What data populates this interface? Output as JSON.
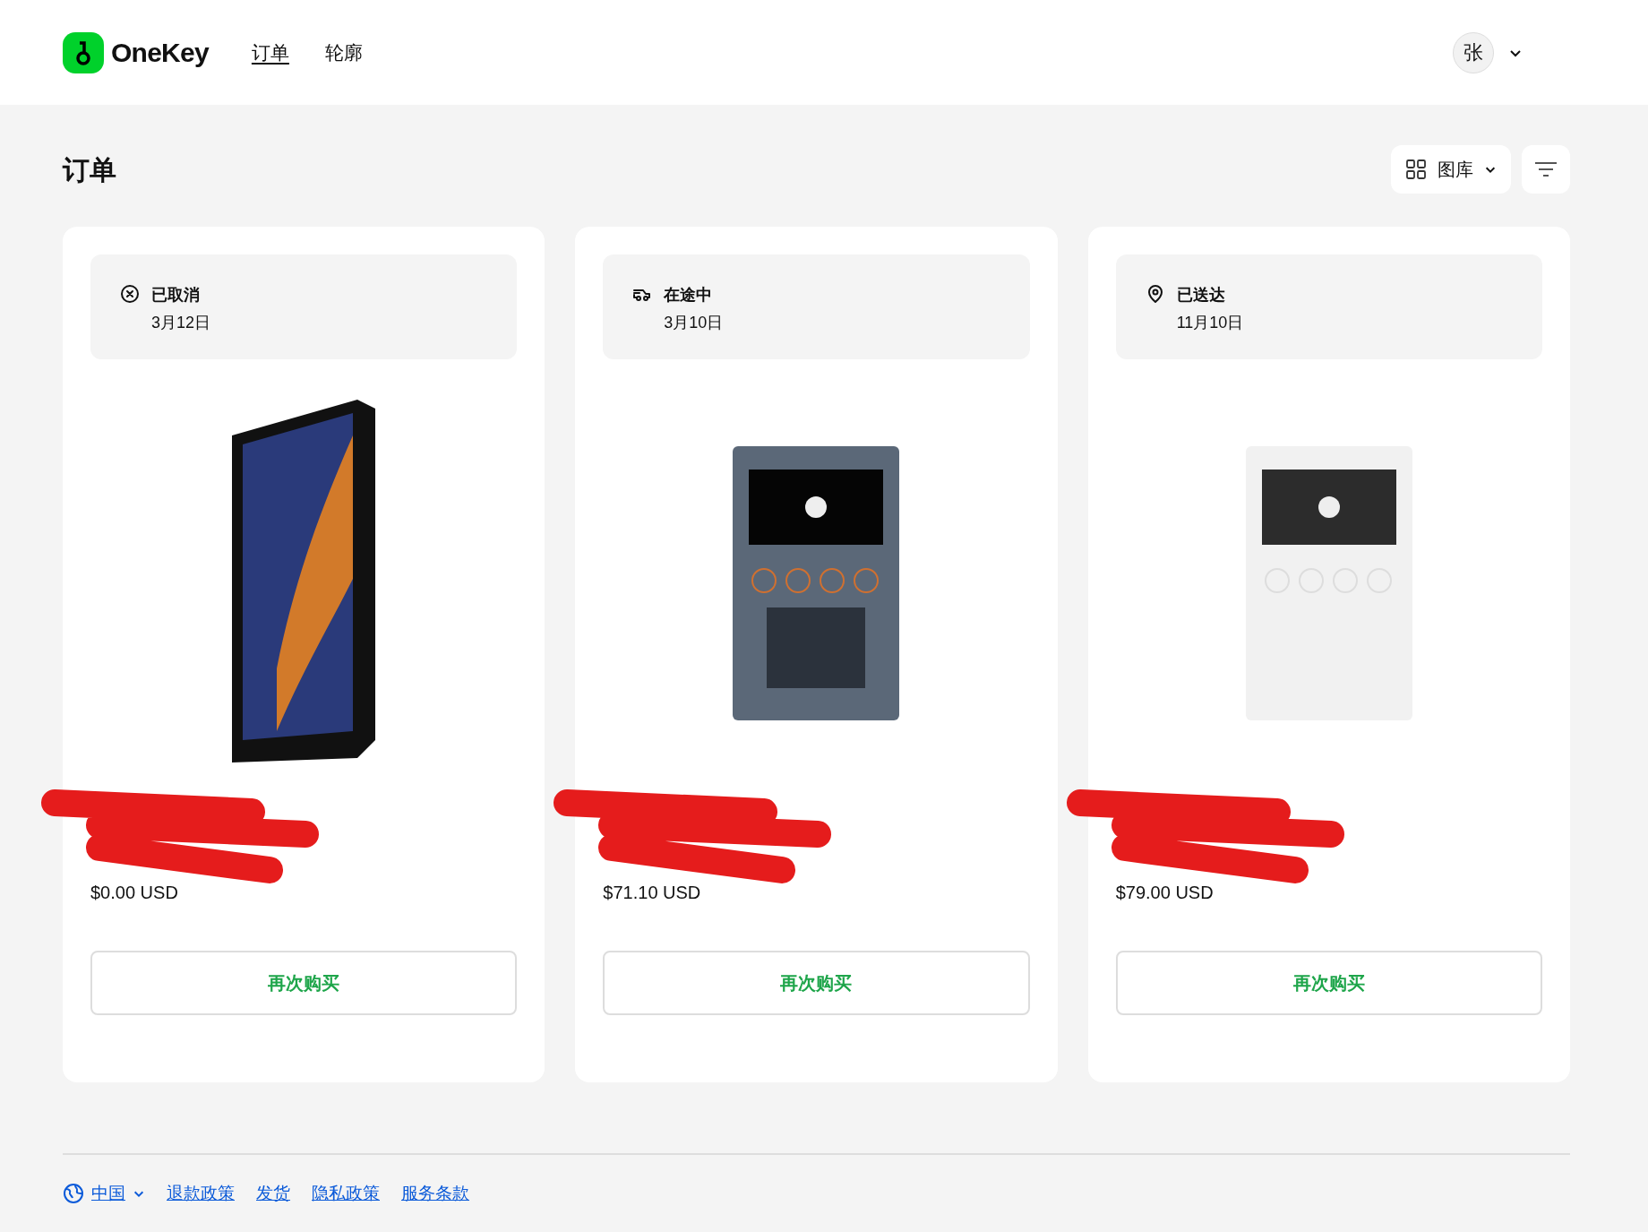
{
  "header": {
    "logo": "OneKey",
    "nav": [
      {
        "label": "订单",
        "selected": true
      },
      {
        "label": "轮廓",
        "selected": false
      }
    ],
    "avatar": "张"
  },
  "page": {
    "title": "订单",
    "view_button": "图库"
  },
  "orders": [
    {
      "kind": "cancelled",
      "status": "已取消",
      "date": "3月12日",
      "photo": {
        "kind": "phone"
      },
      "price": "$0.00 USD",
      "button": "再次购买"
    },
    {
      "kind": "shipping",
      "status": "在途中",
      "date": "3月10日",
      "photo": {
        "kind": "dark"
      },
      "price": "$71.10 USD",
      "button": "再次购买"
    },
    {
      "kind": "delivered",
      "status": "已送达",
      "date": "11月10日",
      "photo": {
        "kind": "light"
      },
      "price": "$79.00 USD",
      "button": "再次购买"
    }
  ],
  "footer": {
    "region": "中国",
    "links": [
      "退款政策",
      "发货",
      "隐私政策",
      "服务条款"
    ]
  }
}
